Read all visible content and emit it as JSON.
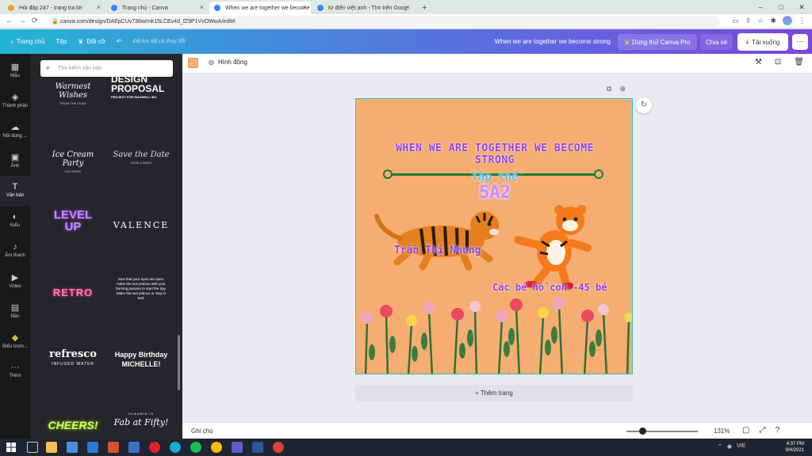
{
  "browser": {
    "tabs": [
      {
        "title": "Hỏi đáp 247 - trang tra lời",
        "color": "#f0a030",
        "active": false
      },
      {
        "title": "Trang chủ - Canva",
        "color": "#3b82f6",
        "active": false
      },
      {
        "title": "When we are together we become",
        "color": "#3b82f6",
        "active": true
      },
      {
        "title": "từ điển việt anh - Tìm trên Goog",
        "color": "#4285f4",
        "active": false
      }
    ],
    "new_tab": "+",
    "url": "canva.com/design/DAEpCUv736w/mk15LCEv4d_fZ9P1VvOWwA/edit#",
    "window_controls": [
      "–",
      "□",
      "✕"
    ]
  },
  "header": {
    "home": "Trang chủ",
    "file": "Tệp",
    "resize": "Đổi cỡ",
    "saved": "Đã lưu tất cả thay đổi",
    "doc_title": "When we are together we become strong",
    "try_pro": "Dùng thử Canva Pro",
    "share": "Chia sẻ",
    "download": "Tải xuống",
    "more": "···"
  },
  "rail": [
    {
      "label": "Mẫu",
      "icon": "▦",
      "active": false
    },
    {
      "label": "Thành phần",
      "icon": "◈",
      "active": false
    },
    {
      "label": "Nội dung ...",
      "icon": "☁",
      "active": false
    },
    {
      "label": "Ảnh",
      "icon": "▣",
      "active": false
    },
    {
      "label": "Văn bản",
      "icon": "T",
      "active": true
    },
    {
      "label": "Kiểu",
      "icon": "◐",
      "active": false
    },
    {
      "label": "Âm thanh",
      "icon": "♪",
      "active": false
    },
    {
      "label": "Video",
      "icon": "▶",
      "active": false
    },
    {
      "label": "Nền",
      "icon": "▤",
      "active": false
    },
    {
      "label": "Biểu tượn...",
      "icon": "◆",
      "active": false
    },
    {
      "label": "Thêm",
      "icon": "···",
      "active": false
    }
  ],
  "panel": {
    "search_placeholder": "Tìm kiếm văn bản",
    "templates": [
      {
        "main": "Warmest Wishes",
        "sub": "FROM THE TEAM",
        "color": "#ffffff",
        "style": "script"
      },
      {
        "main": "DESIGN PROPOSAL",
        "sub": "PROJECT FOR MAXWELL INC",
        "color": "#ffffff",
        "style": "bold"
      },
      {
        "main": "Ice Cream Party",
        "sub": "SATURDAY",
        "color": "#ffffff",
        "style": "script"
      },
      {
        "main": "Save the Date",
        "sub": "JOHN & MARY",
        "color": "#ffffff",
        "style": "script"
      },
      {
        "main": "LEVEL UP",
        "sub": "",
        "color": "#b36bff",
        "style": "neon"
      },
      {
        "main": "VALENCE",
        "sub": "",
        "color": "#ffffff",
        "style": "serif"
      },
      {
        "main": "RETRO",
        "sub": "",
        "color": "#ff5fa2",
        "style": "neon"
      },
      {
        "main": "Now that your eyes are open, make the sun jealous with your burning passion to start the day. Make the sun jealous or stay in bed.",
        "sub": "",
        "color": "#ffffff",
        "style": "small"
      },
      {
        "main": "refresco",
        "sub": "INFUSED WATER",
        "color": "#ffffff",
        "style": "serif-bold"
      },
      {
        "main": "Happy Birthday MICHELLE!",
        "sub": "",
        "color": "#ffffff",
        "style": "script"
      },
      {
        "main": "CHEERS!",
        "sub": "",
        "color": "#c6f25a",
        "style": "bold"
      },
      {
        "main": "Fab at Fifty!",
        "sub": "CLAUDIA IS",
        "color": "#ffffff",
        "style": "script"
      }
    ]
  },
  "editor": {
    "animate": "Hình động",
    "swatch_color": "#f6ad71",
    "add_page": "+ Thêm trang"
  },
  "design": {
    "bg_color": "#f6ad71",
    "title": "When we are together we become strong",
    "class_label": "Tập thể",
    "class_name": "5A2",
    "teacher": "Trần Thị Nhung",
    "kids": "Các bé hổ con -45 bé"
  },
  "status": {
    "notes": "Ghi chú",
    "zoom": "131%",
    "zoom_fraction": 0.22
  },
  "taskbar": {
    "time": "4:37 PM",
    "date": "9/4/2021",
    "lang": "VIE"
  }
}
